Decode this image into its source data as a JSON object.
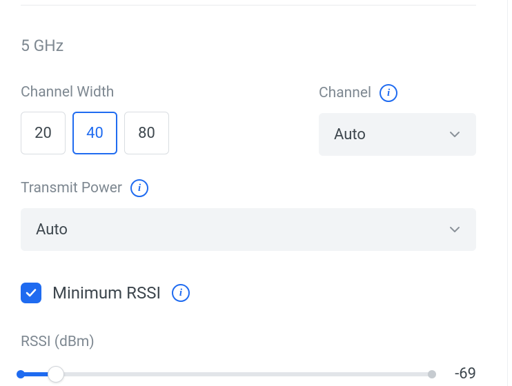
{
  "section_title": "5 GHz",
  "channel_width": {
    "label": "Channel Width",
    "options": [
      "20",
      "40",
      "80"
    ],
    "selected": "40"
  },
  "channel": {
    "label": "Channel",
    "value": "Auto"
  },
  "transmit_power": {
    "label": "Transmit Power",
    "value": "Auto"
  },
  "minimum_rssi": {
    "label": "Minimum RSSI",
    "checked": true
  },
  "rssi": {
    "label": "RSSI (dBm)",
    "value": "-69"
  },
  "icons": {
    "info_glyph": "i"
  }
}
